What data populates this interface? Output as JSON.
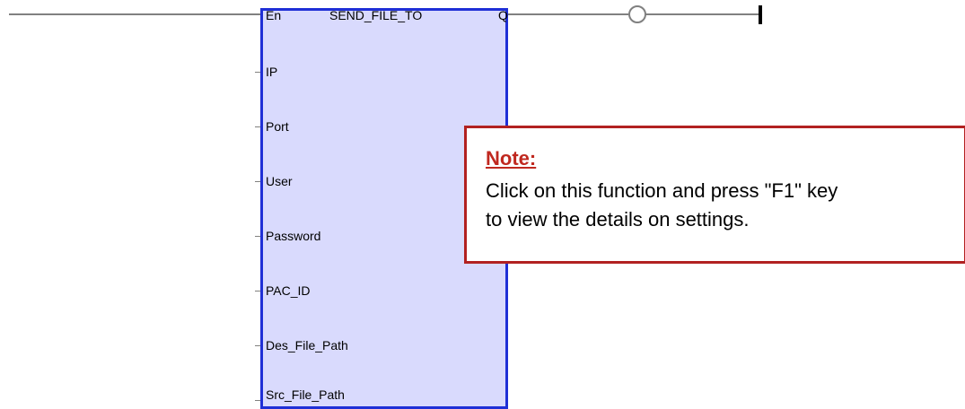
{
  "block": {
    "name": "SEND_FILE_TO",
    "enable_input": "En",
    "output": "Q",
    "inputs": [
      "IP",
      "Port",
      "User",
      "Password",
      "PAC_ID",
      "Des_File_Path",
      "Src_File_Path"
    ]
  },
  "note": {
    "title": "Note:",
    "lines": [
      "Click on this function and press \"F1\" key",
      "to view the details on settings."
    ]
  },
  "colors": {
    "block_fill": "#d9dafd",
    "block_border": "#1f2fd6",
    "note_border": "#b22121",
    "note_title": "#c0281f",
    "arrow": "#c0281f",
    "rung_line": "#808080"
  }
}
